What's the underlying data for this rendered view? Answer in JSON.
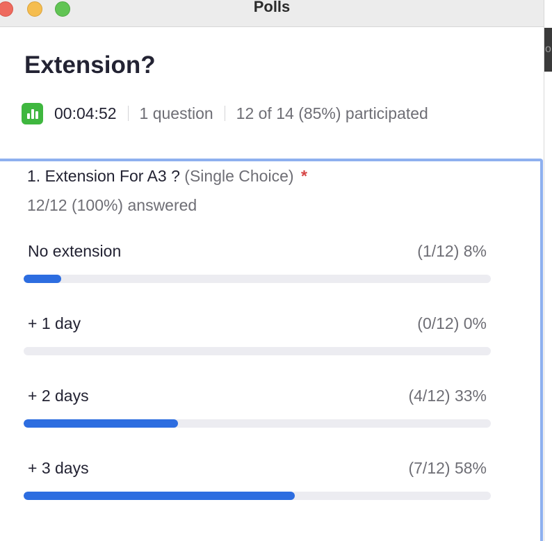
{
  "window": {
    "title": "Polls"
  },
  "poll": {
    "title": "Extension?",
    "timer": "00:04:52",
    "questions_count": "1 question",
    "participation": "12 of 14 (85%) participated"
  },
  "question": {
    "title": "1. Extension For A3 ?",
    "type": "(Single Choice)",
    "required_mark": "*",
    "answered": "12/12 (100%) answered",
    "options": [
      {
        "label": "No extension",
        "result": "(1/12) 8%",
        "fraction": 0.08
      },
      {
        "label": "+ 1 day",
        "result": "(0/12) 0%",
        "fraction": 0.0
      },
      {
        "label": "+ 2 days",
        "result": "(4/12) 33%",
        "fraction": 0.33
      },
      {
        "label": "+ 3 days",
        "result": "(7/12) 58%",
        "fraction": 0.58
      }
    ]
  },
  "colors": {
    "bar_fill": "#2d6de0",
    "bar_track": "#ececf1",
    "card_border": "#8eb0ef",
    "badge_green": "#3fb73f",
    "required_red": "#d64545"
  },
  "icons": {
    "poll_badge": "bar-chart-icon"
  }
}
